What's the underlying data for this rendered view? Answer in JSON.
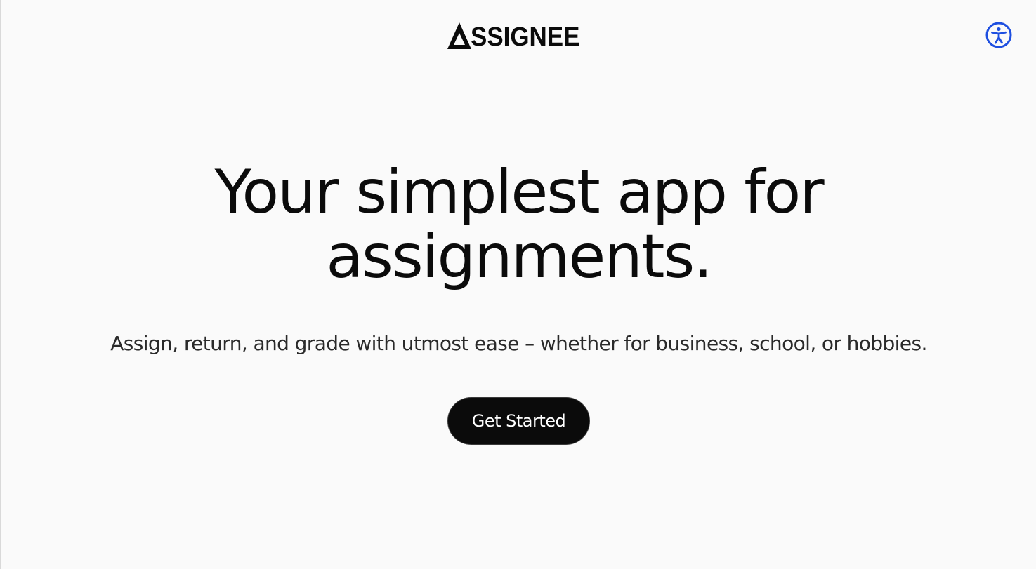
{
  "header": {
    "logo_text": "SSIGNEE",
    "logo_full": "ASSIGNEE",
    "logo_mark_icon": "triangle-a-icon",
    "accessibility_icon": "accessibility-person-icon",
    "accessibility_color": "#1e4fe0"
  },
  "hero": {
    "headline": "Your simplest app for assignments.",
    "subtitle": "Assign, return, and grade with utmost ease – whether for business, school, or hobbies.",
    "cta_label": "Get Started"
  },
  "colors": {
    "background": "#fafafa",
    "text": "#0b0b0b",
    "button_bg": "#0b0b0b",
    "button_text": "#ffffff"
  }
}
